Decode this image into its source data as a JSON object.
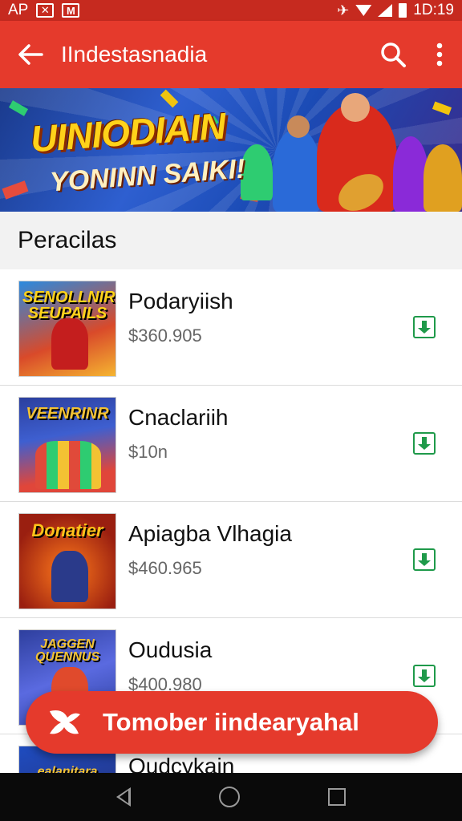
{
  "status_bar": {
    "left_text": "AP",
    "time": "1D:19",
    "icons": [
      "x-box-icon",
      "m-box-icon",
      "mute-icon",
      "wifi-icon",
      "signal-icon",
      "battery-icon"
    ]
  },
  "app_bar": {
    "title": "IIndestasnadia",
    "icons": [
      "back-arrow-icon",
      "search-icon",
      "more-vert-icon"
    ]
  },
  "banner": {
    "title": "UINIODIAIN",
    "subtitle": "YONINN SAIKI!"
  },
  "section": {
    "title": "Peracilas"
  },
  "items": [
    {
      "thumb_text": "SENOLLNIR SEUPAILS",
      "name": "Podaryiish",
      "price": "$360.905",
      "thumb_colors": [
        "#d94a2a",
        "#f5b531",
        "#2a8ae0"
      ]
    },
    {
      "thumb_text": "VEENRINR",
      "name": "Cnaclariih",
      "price": "$10n",
      "thumb_colors": [
        "#2b3f9e",
        "#f3c233",
        "#e0463a"
      ]
    },
    {
      "thumb_text": "Donatier",
      "name": "Apiagba Vlhagia",
      "price": "$460.965",
      "thumb_colors": [
        "#9a1f10",
        "#ff7a1c",
        "#2a3a8a"
      ]
    },
    {
      "thumb_text": "JAGGEN QUENNUS",
      "name": "Oudusia",
      "price": "$400.980",
      "thumb_colors": [
        "#2e3f9e",
        "#e04a2c",
        "#f2c233"
      ]
    },
    {
      "thumb_text": "ealanitara",
      "name": "Oudcykain",
      "price": "",
      "thumb_colors": [
        "#1e4cc0",
        "#f3c233",
        "#2a2a6a"
      ]
    }
  ],
  "fab": {
    "label": "Tomober iindearyahal",
    "icon": "brand-swirl-icon"
  },
  "nav_bar": {
    "icons": [
      "nav-back-icon",
      "nav-home-icon",
      "nav-recents-icon"
    ]
  },
  "colors": {
    "primary": "#e53a2c",
    "status_bar": "#c62a1f",
    "download_green": "#1f9a4a"
  }
}
